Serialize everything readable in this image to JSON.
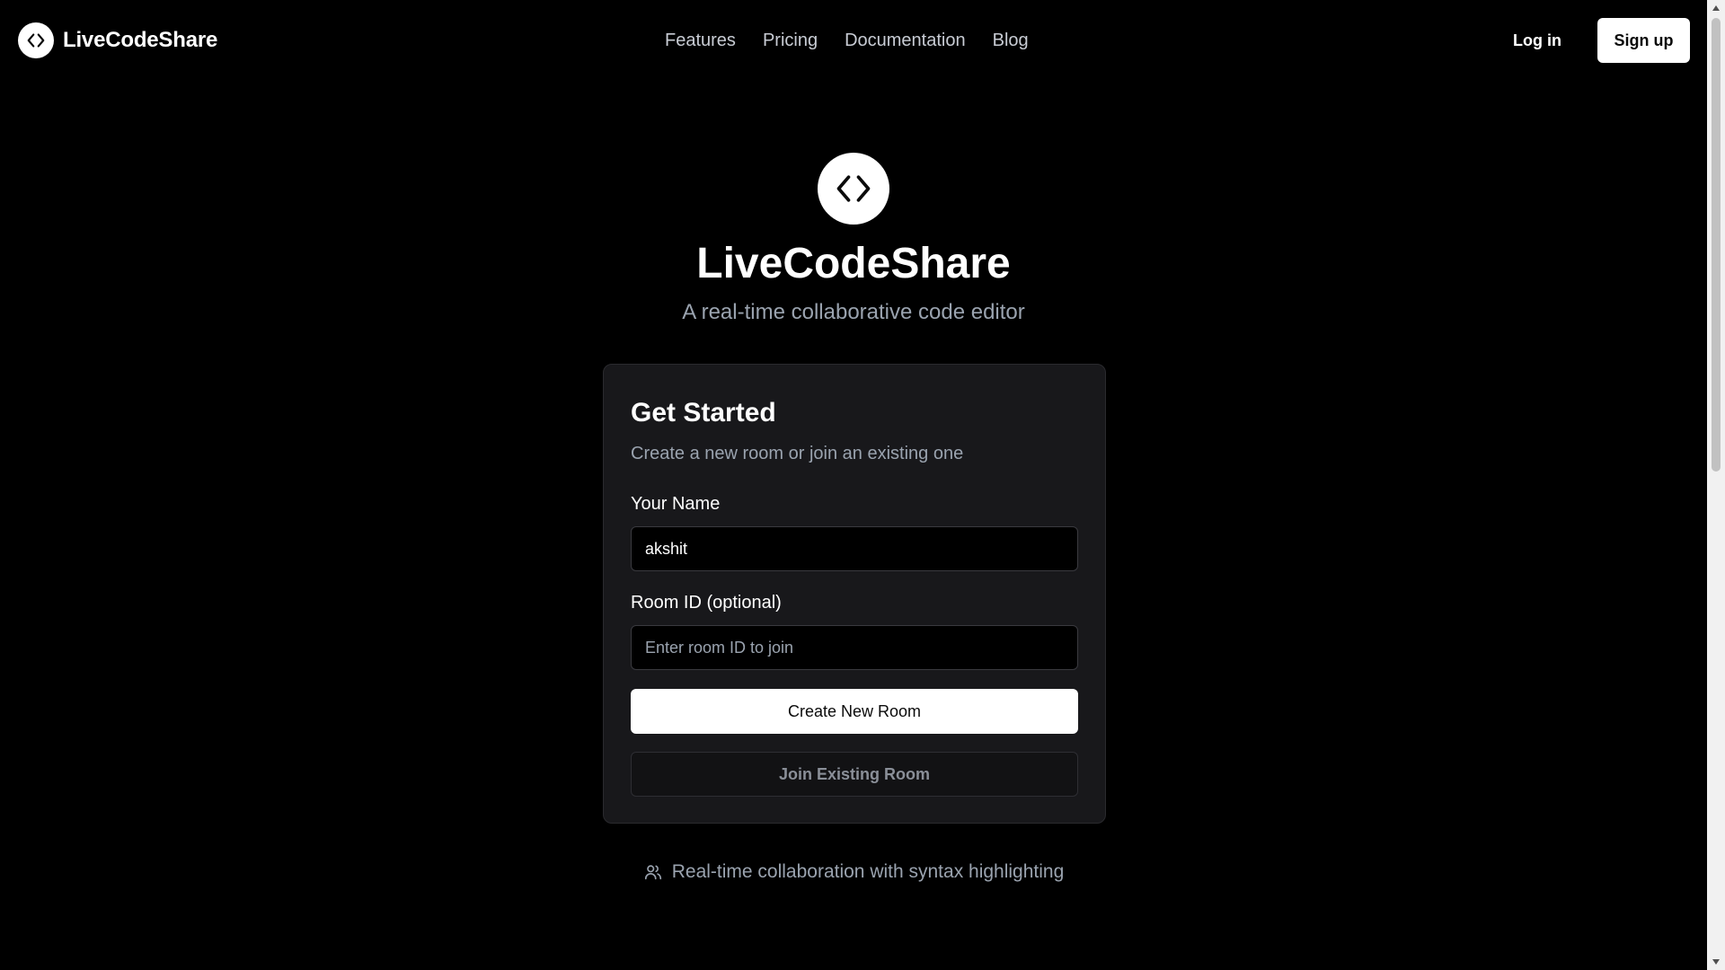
{
  "nav": {
    "brand_name": "LiveCodeShare",
    "brand_icon": "code-brackets-icon",
    "links": [
      {
        "label": "Features"
      },
      {
        "label": "Pricing"
      },
      {
        "label": "Documentation"
      },
      {
        "label": "Blog"
      }
    ],
    "login_label": "Log in",
    "signup_label": "Sign up"
  },
  "hero": {
    "icon": "code-brackets-icon",
    "title": "LiveCodeShare",
    "subtitle": "A real-time collaborative code editor"
  },
  "card": {
    "title": "Get Started",
    "description": "Create a new room or join an existing one",
    "name_label": "Your Name",
    "name_value": "akshit",
    "room_label": "Room ID (optional)",
    "room_value": "",
    "room_placeholder": "Enter room ID to join",
    "create_button": "Create New Room",
    "join_button": "Join Existing Room"
  },
  "feature_note": {
    "icon": "users-icon",
    "text": "Real-time collaboration with syntax highlighting"
  },
  "colors": {
    "background": "#000000",
    "card_background": "#18181b",
    "muted_text": "#9aa3af",
    "primary_button": "#ffffff"
  }
}
